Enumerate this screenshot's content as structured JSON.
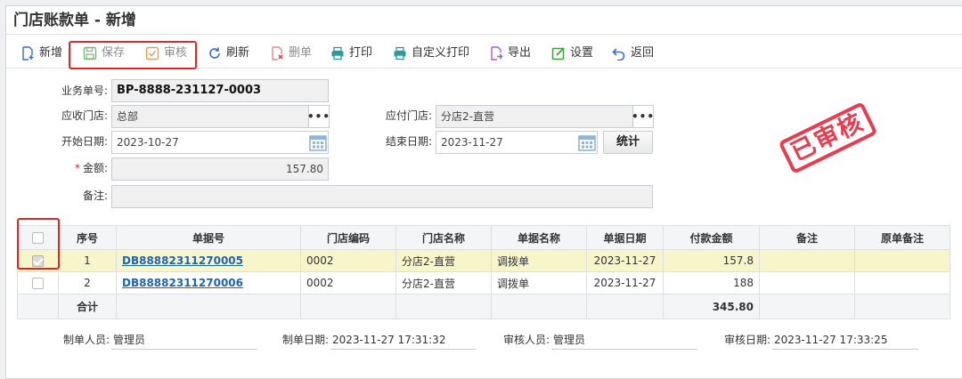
{
  "page": {
    "title": "门店账款单 - 新增"
  },
  "toolbar": {
    "add": "新增",
    "save": "保存",
    "audit": "审核",
    "refresh": "刷新",
    "delete": "删单",
    "print": "打印",
    "custom_print": "自定义打印",
    "export": "导出",
    "settings": "设置",
    "back": "返回"
  },
  "form": {
    "doc_no_label": "业务单号:",
    "doc_no": "BP-8888-231127-0003",
    "recv_store_label": "应收门店:",
    "recv_store": "总部",
    "pay_store_label": "应付门店:",
    "pay_store": "分店2-直营",
    "start_label": "开始日期:",
    "start_date": "2023-10-27",
    "end_label": "结束日期:",
    "end_date": "2023-11-27",
    "stat_button": "统计",
    "amount_label": "金额:",
    "amount": "157.80",
    "remark_label": "备注:",
    "remark": ""
  },
  "stamp": "已审核",
  "table": {
    "headers": [
      "",
      "序号",
      "单据号",
      "门店编码",
      "门店名称",
      "单据名称",
      "单据日期",
      "付款金额",
      "备注",
      "原单备注"
    ],
    "rows": [
      {
        "checked": true,
        "seq": "1",
        "doc_no": "DB88882311270005",
        "store_code": "0002",
        "store_name": "分店2-直营",
        "doc_name": "调拨单",
        "doc_date": "2023-11-27",
        "amount": "157.8",
        "remark": "",
        "orig_remark": ""
      },
      {
        "checked": false,
        "seq": "2",
        "doc_no": "DB88882311270006",
        "store_code": "0002",
        "store_name": "分店2-直营",
        "doc_name": "调拨单",
        "doc_date": "2023-11-27",
        "amount": "188",
        "remark": "",
        "orig_remark": ""
      }
    ],
    "sum_label": "合计",
    "sum_amount": "345.80"
  },
  "footer": {
    "maker_label": "制单人员:",
    "maker": "管理员",
    "make_date_label": "制单日期:",
    "make_date": "2023-11-27 17:31:32",
    "auditor_label": "审核人员:",
    "auditor": "管理员",
    "audit_date_label": "审核日期:",
    "audit_date": "2023-11-27 17:33:25"
  },
  "colors": {
    "highlight": "#e32424",
    "selected_row": "#f7f5c9",
    "link": "#1f64b4",
    "stamp": "#e8283b"
  }
}
